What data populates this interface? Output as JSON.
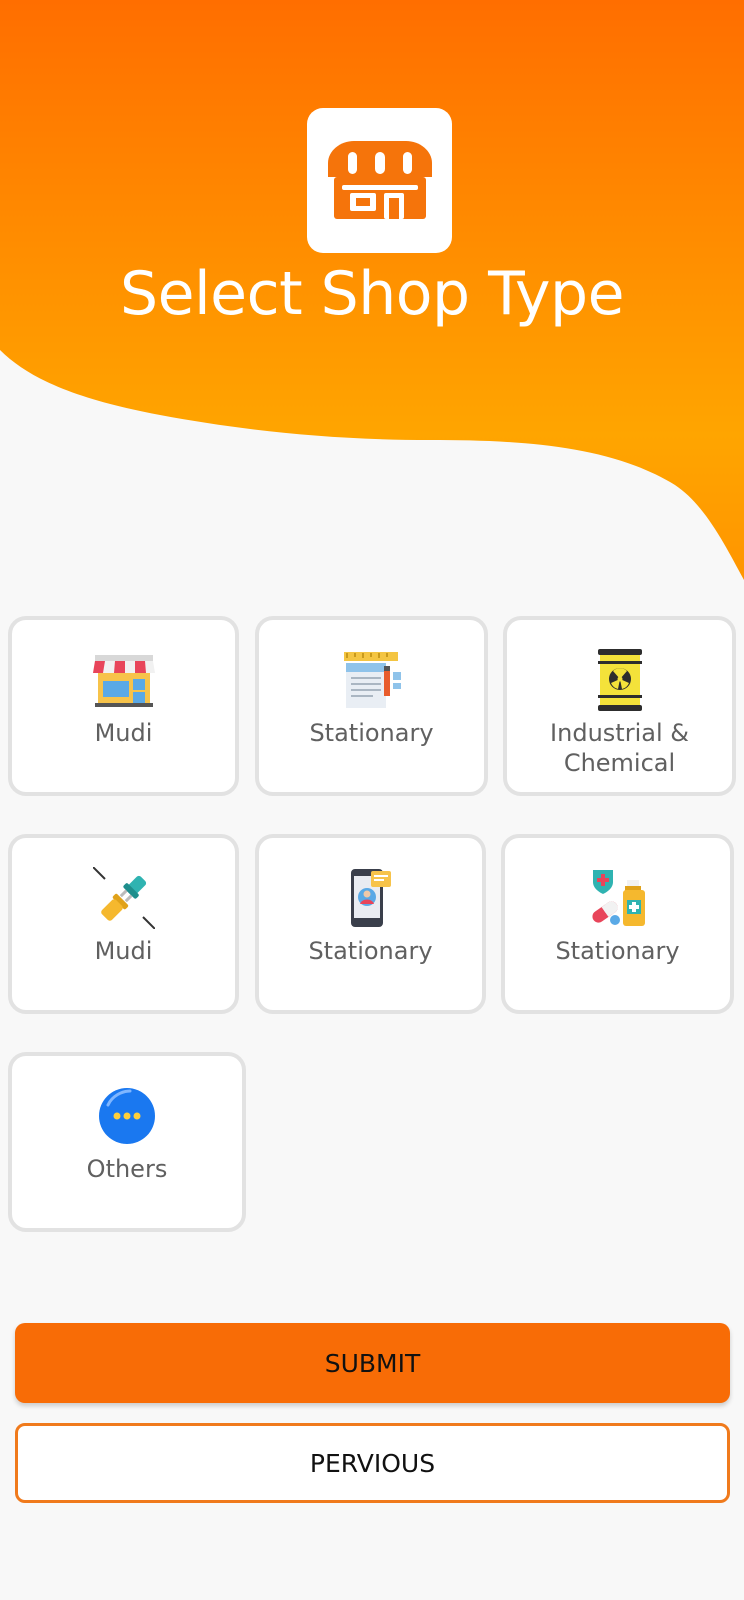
{
  "header": {
    "title": "Select Shop Type",
    "icon": "shop-icon"
  },
  "shop_types": [
    {
      "label": "Mudi",
      "icon": "storefront-icon"
    },
    {
      "label": "Stationary",
      "icon": "notepad-pencil-icon"
    },
    {
      "label": "Industrial & Chemical",
      "icon": "hazard-barrel-icon"
    },
    {
      "label": "Mudi",
      "icon": "electric-plug-icon"
    },
    {
      "label": "Stationary",
      "icon": "mobile-phone-icon"
    },
    {
      "label": "Stationary",
      "icon": "medicine-icon"
    },
    {
      "label": "Others",
      "icon": "more-dots-icon"
    }
  ],
  "buttons": {
    "submit_label": "SUBMIT",
    "previous_label": "PERVIOUS"
  },
  "colors": {
    "header_gradient_top": "#ff6f00",
    "header_gradient_bottom": "#ffaa00",
    "primary": "#f86c06",
    "card_border": "#e2e2e2",
    "background": "#f8f8f8"
  }
}
